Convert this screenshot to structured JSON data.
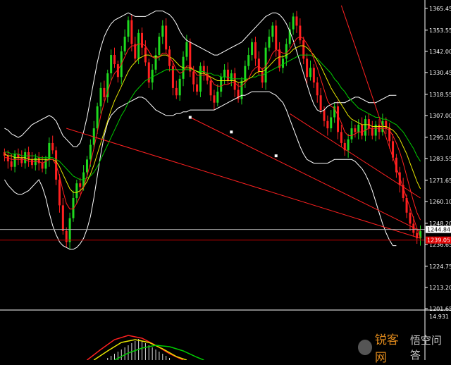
{
  "chart_data": {
    "type": "candlestick",
    "price_axis": {
      "ticks": [
        "1365.45",
        "1353.55",
        "1342.00",
        "1330.45",
        "1318.55",
        "1307.00",
        "1295.10",
        "1283.55",
        "1271.65",
        "1260.10",
        "1248.20",
        "1236.65",
        "1224.75",
        "1213.20",
        "1201.65"
      ],
      "range": [
        1201.65,
        1370.0
      ]
    },
    "current_price_label": "1244.84",
    "red_level_label": "1239.05",
    "indicator_axis": {
      "tick": "14.931"
    },
    "colors": {
      "bull": "#1fd91f",
      "bear": "#ff2020",
      "band": "#ffffff",
      "ma_fast": "#ff2020",
      "ma_mid": "#e6e600",
      "ma_slow": "#00cc00",
      "trend": "#ff2020",
      "level_line": "#c00000",
      "current_line": "#b0b0b0"
    },
    "series": [
      {
        "name": "close",
        "values": [
          1285,
          1282,
          1279,
          1286,
          1284,
          1281,
          1287,
          1283,
          1280,
          1284,
          1281,
          1278,
          1283,
          1292,
          1288,
          1272,
          1258,
          1244,
          1238,
          1251,
          1262,
          1270,
          1268,
          1276,
          1283,
          1291,
          1300,
          1312,
          1322,
          1317,
          1330,
          1340,
          1335,
          1328,
          1342,
          1350,
          1359,
          1346,
          1338,
          1352,
          1344,
          1336,
          1325,
          1332,
          1340,
          1350,
          1356,
          1343,
          1334,
          1322,
          1318,
          1327,
          1339,
          1347,
          1331,
          1324,
          1320,
          1334,
          1330,
          1326,
          1318,
          1314,
          1320,
          1328,
          1332,
          1326,
          1330,
          1321,
          1316,
          1326,
          1334,
          1340,
          1347,
          1338,
          1331,
          1325,
          1344,
          1350,
          1356,
          1343,
          1333,
          1338,
          1346,
          1354,
          1361,
          1356,
          1348,
          1338,
          1328,
          1333,
          1325,
          1318,
          1310,
          1304,
          1300,
          1306,
          1312,
          1298,
          1292,
          1288,
          1294,
          1300,
          1298,
          1302,
          1296,
          1305,
          1300,
          1296,
          1302,
          1298,
          1304,
          1300,
          1293,
          1284,
          1276,
          1269,
          1262,
          1254,
          1248,
          1243,
          1240,
          1244
        ]
      },
      {
        "name": "upper_band",
        "values": [
          1300,
          1299,
          1297,
          1296,
          1295,
          1296,
          1298,
          1300,
          1302,
          1303,
          1304,
          1305,
          1306,
          1307,
          1306,
          1304,
          1300,
          1296,
          1294,
          1292,
          1290,
          1290,
          1292,
          1298,
          1306,
          1316,
          1326,
          1336,
          1344,
          1350,
          1354,
          1357,
          1359,
          1360,
          1361,
          1362,
          1363,
          1362,
          1361,
          1361,
          1361,
          1361,
          1362,
          1363,
          1364,
          1364,
          1364,
          1363,
          1362,
          1360,
          1357,
          1353,
          1350,
          1348,
          1347,
          1346,
          1345,
          1344,
          1343,
          1342,
          1341,
          1340,
          1340,
          1341,
          1342,
          1343,
          1344,
          1345,
          1346,
          1347,
          1349,
          1351,
          1353,
          1355,
          1357,
          1359,
          1361,
          1362,
          1363,
          1363,
          1362,
          1360,
          1357,
          1353,
          1348,
          1342,
          1336,
          1330,
          1324,
          1318,
          1313,
          1310,
          1309,
          1310,
          1312,
          1313,
          1314,
          1314,
          1314,
          1314,
          1315,
          1316,
          1317,
          1317,
          1316,
          1315,
          1314,
          1314,
          1314,
          1315,
          1316,
          1317,
          1318,
          1318,
          1318
        ]
      },
      {
        "name": "lower_band",
        "values": [
          1272,
          1269,
          1267,
          1265,
          1264,
          1264,
          1265,
          1266,
          1268,
          1270,
          1272,
          1268,
          1262,
          1254,
          1247,
          1242,
          1238,
          1236,
          1235,
          1234,
          1234,
          1235,
          1237,
          1240,
          1245,
          1252,
          1262,
          1274,
          1286,
          1296,
          1303,
          1307,
          1309,
          1311,
          1312,
          1313,
          1314,
          1315,
          1316,
          1317,
          1317,
          1316,
          1314,
          1312,
          1310,
          1309,
          1308,
          1307,
          1307,
          1307,
          1308,
          1308,
          1309,
          1309,
          1310,
          1310,
          1310,
          1310,
          1310,
          1310,
          1310,
          1310,
          1311,
          1312,
          1313,
          1314,
          1315,
          1316,
          1317,
          1318,
          1318,
          1319,
          1320,
          1320,
          1320,
          1320,
          1320,
          1320,
          1319,
          1318,
          1316,
          1314,
          1310,
          1305,
          1300,
          1295,
          1290,
          1286,
          1283,
          1282,
          1281,
          1281,
          1281,
          1281,
          1281,
          1282,
          1283,
          1283,
          1283,
          1283,
          1283,
          1283,
          1282,
          1280,
          1278,
          1275,
          1271,
          1266,
          1260,
          1254,
          1248,
          1243,
          1239,
          1236,
          1236
        ]
      },
      {
        "name": "ma_fast",
        "values": [
          1284,
          1284,
          1283,
          1283,
          1283,
          1283,
          1283,
          1282,
          1282,
          1282,
          1282,
          1281,
          1282,
          1283,
          1283,
          1280,
          1274,
          1266,
          1259,
          1256,
          1256,
          1259,
          1263,
          1268,
          1274,
          1281,
          1289,
          1298,
          1307,
          1314,
          1320,
          1326,
          1330,
          1332,
          1335,
          1339,
          1343,
          1345,
          1345,
          1346,
          1346,
          1345,
          1342,
          1339,
          1338,
          1339,
          1341,
          1341,
          1339,
          1336,
          1332,
          1330,
          1331,
          1334,
          1334,
          1332,
          1329,
          1329,
          1329,
          1329,
          1327,
          1324,
          1323,
          1323,
          1324,
          1324,
          1325,
          1325,
          1323,
          1323,
          1325,
          1327,
          1331,
          1333,
          1334,
          1332,
          1334,
          1337,
          1341,
          1343,
          1342,
          1341,
          1341,
          1343,
          1346,
          1349,
          1350,
          1349,
          1346,
          1343,
          1338,
          1333,
          1327,
          1321,
          1315,
          1312,
          1311,
          1307,
          1303,
          1298,
          1296,
          1296,
          1297,
          1298,
          1298,
          1299,
          1300,
          1300,
          1300,
          1300,
          1300,
          1300,
          1299,
          1296,
          1292,
          1287,
          1281,
          1274,
          1267,
          1260,
          1254,
          1250
        ]
      },
      {
        "name": "ma_mid",
        "values": [
          1286,
          1285,
          1285,
          1284,
          1284,
          1284,
          1284,
          1283,
          1283,
          1283,
          1283,
          1283,
          1283,
          1283,
          1283,
          1282,
          1279,
          1275,
          1271,
          1267,
          1265,
          1265,
          1266,
          1268,
          1271,
          1275,
          1280,
          1286,
          1292,
          1298,
          1304,
          1310,
          1315,
          1319,
          1323,
          1327,
          1331,
          1334,
          1336,
          1338,
          1339,
          1340,
          1340,
          1339,
          1339,
          1339,
          1340,
          1340,
          1339,
          1338,
          1336,
          1334,
          1333,
          1333,
          1333,
          1332,
          1331,
          1330,
          1330,
          1329,
          1328,
          1327,
          1326,
          1326,
          1326,
          1326,
          1326,
          1326,
          1325,
          1325,
          1326,
          1327,
          1328,
          1330,
          1331,
          1331,
          1332,
          1334,
          1336,
          1338,
          1339,
          1339,
          1340,
          1341,
          1343,
          1344,
          1345,
          1345,
          1344,
          1342,
          1340,
          1337,
          1334,
          1330,
          1326,
          1322,
          1319,
          1316,
          1313,
          1310,
          1307,
          1305,
          1304,
          1303,
          1302,
          1302,
          1302,
          1301,
          1301,
          1301,
          1301,
          1301,
          1300,
          1299,
          1297,
          1294,
          1290,
          1286,
          1281,
          1276,
          1271,
          1267
        ]
      },
      {
        "name": "ma_slow",
        "values": [
          1287,
          1287,
          1286,
          1286,
          1286,
          1285,
          1285,
          1285,
          1285,
          1285,
          1284,
          1284,
          1284,
          1284,
          1284,
          1283,
          1282,
          1280,
          1278,
          1276,
          1274,
          1273,
          1272,
          1272,
          1273,
          1274,
          1276,
          1279,
          1283,
          1287,
          1291,
          1295,
          1299,
          1303,
          1307,
          1310,
          1314,
          1317,
          1320,
          1322,
          1324,
          1326,
          1327,
          1328,
          1329,
          1330,
          1331,
          1332,
          1332,
          1332,
          1332,
          1332,
          1332,
          1332,
          1332,
          1332,
          1331,
          1331,
          1331,
          1330,
          1330,
          1329,
          1329,
          1328,
          1328,
          1328,
          1327,
          1327,
          1327,
          1327,
          1327,
          1327,
          1328,
          1328,
          1329,
          1329,
          1330,
          1331,
          1332,
          1333,
          1334,
          1335,
          1336,
          1337,
          1338,
          1339,
          1340,
          1340,
          1340,
          1340,
          1339,
          1338,
          1336,
          1334,
          1332,
          1330,
          1327,
          1325,
          1322,
          1320,
          1317,
          1315,
          1313,
          1311,
          1310,
          1309,
          1308,
          1307,
          1306,
          1306,
          1305,
          1305,
          1304,
          1303,
          1302,
          1300,
          1298,
          1295,
          1292,
          1289,
          1285,
          1282
        ]
      }
    ]
  },
  "watermark": {
    "brand": "锐客网",
    "sub": "悟空问答"
  }
}
